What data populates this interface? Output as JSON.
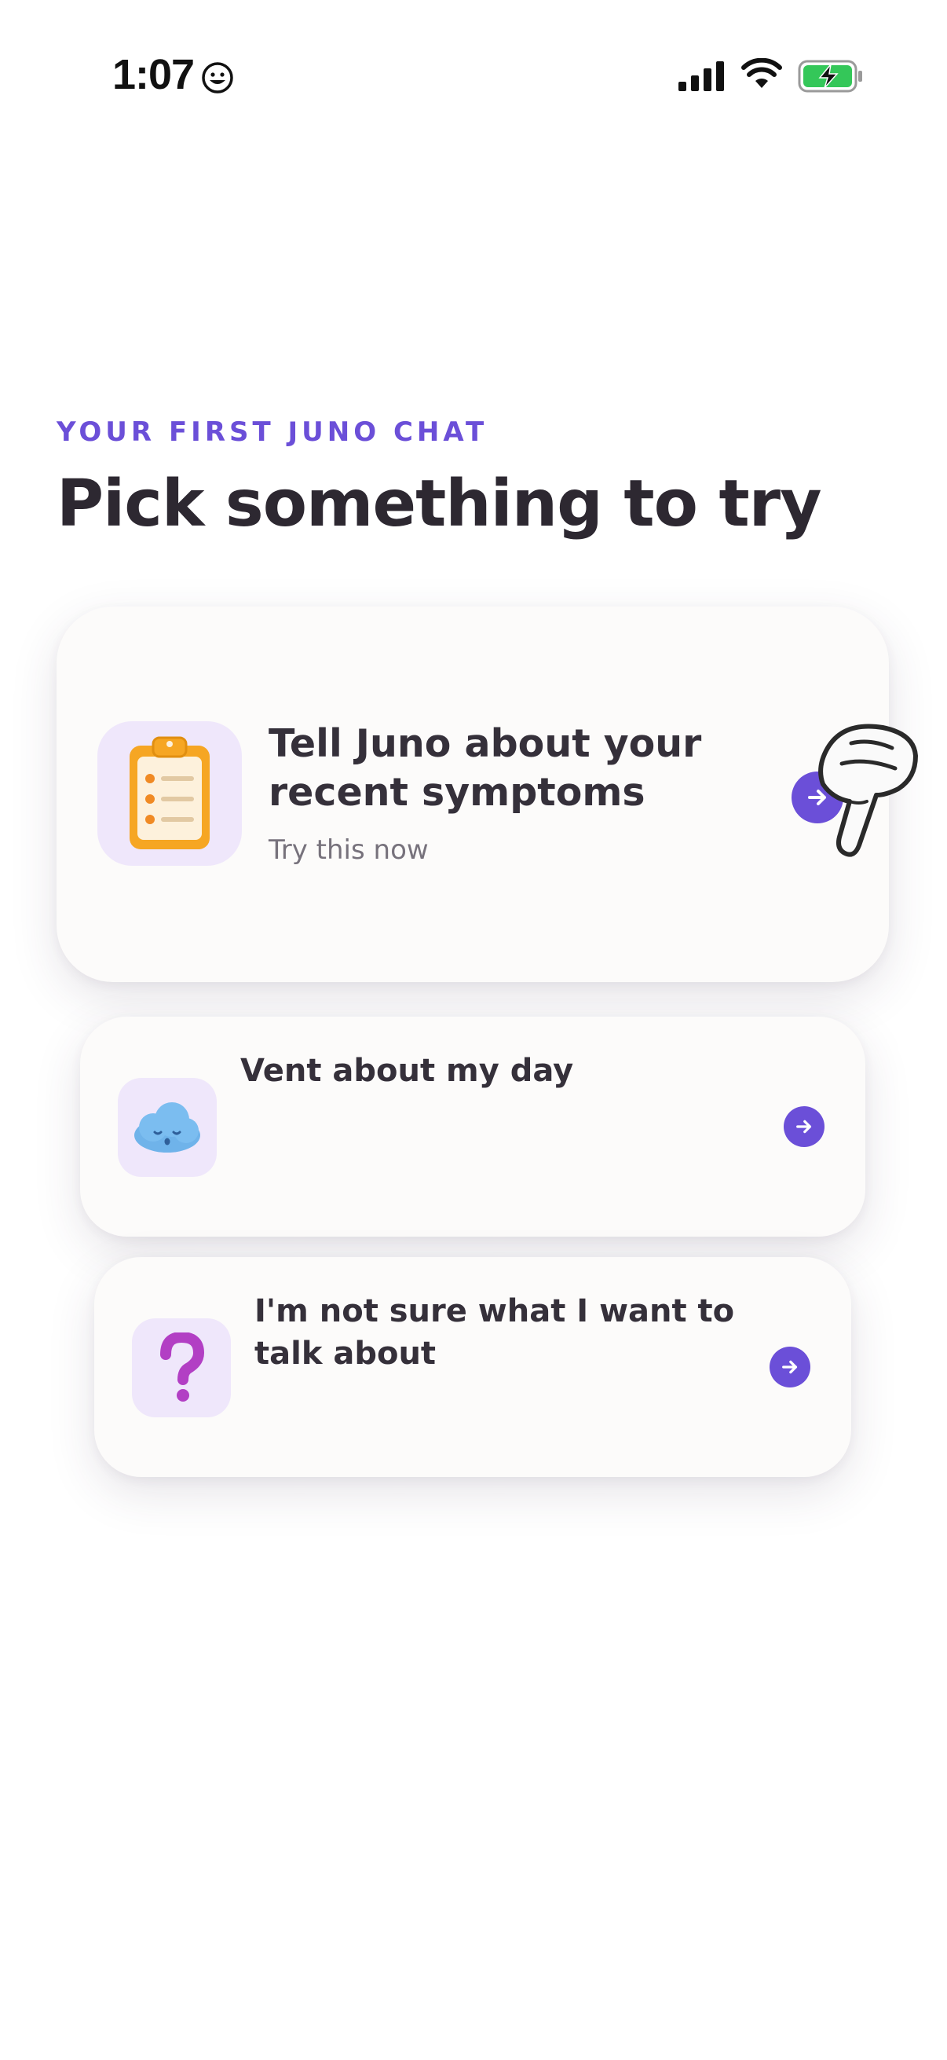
{
  "status_bar": {
    "time": "1:07",
    "face_icon": "smiley-face-icon",
    "signal_icon": "cellular-signal-icon",
    "wifi_icon": "wifi-icon",
    "battery_icon": "battery-charging-icon"
  },
  "header": {
    "eyebrow": "YOUR FIRST JUNO CHAT",
    "title": "Pick something to try"
  },
  "options": [
    {
      "title": "Tell Juno about your recent symptoms",
      "subtitle": "Try this now",
      "icon": "clipboard-icon",
      "arrow_icon": "arrow-right-icon"
    },
    {
      "title": "Vent about my day",
      "icon": "cloud-icon",
      "arrow_icon": "arrow-right-icon"
    },
    {
      "title": "I'm not sure what I want to talk about",
      "icon": "question-mark-icon",
      "arrow_icon": "arrow-right-icon"
    }
  ],
  "overlay": {
    "pointer_icon": "pointing-hand-icon"
  },
  "colors": {
    "accent": "#6b4fd8",
    "text": "#2d2831",
    "muted": "#77727c",
    "card": "#fcfbfa",
    "icon_tile": "#efe7fb"
  }
}
